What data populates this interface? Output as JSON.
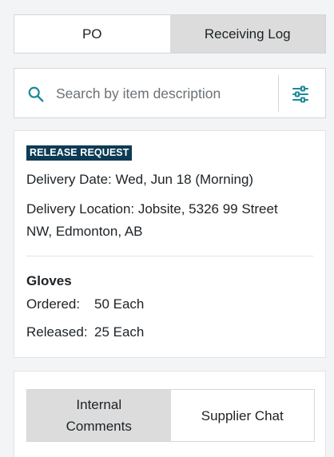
{
  "tabs": {
    "po_label": "PO",
    "receiving_log_label": "Receiving Log",
    "active": "Receiving Log"
  },
  "search": {
    "placeholder": "Search by item description",
    "value": ""
  },
  "icons": {
    "search": "search-icon",
    "filter": "sliders-icon"
  },
  "colors": {
    "accent": "#1a8a9a",
    "badge_bg": "#0d3b55",
    "active_tab_bg": "#dcdcdc"
  },
  "release": {
    "badge": "RELEASE REQUEST",
    "delivery_date": "Delivery Date: Wed, Jun 18 (Morning)",
    "delivery_location": "Delivery Location: Jobsite, 5326 99 Street NW, Edmonton, AB",
    "item": {
      "name": "Gloves",
      "ordered_label": "Ordered:",
      "ordered_value": "50 Each",
      "released_label": "Released:",
      "released_value": "25 Each"
    }
  },
  "comments": {
    "internal_label": "Internal Comments",
    "supplier_label": "Supplier Chat",
    "active": "Internal Comments"
  }
}
